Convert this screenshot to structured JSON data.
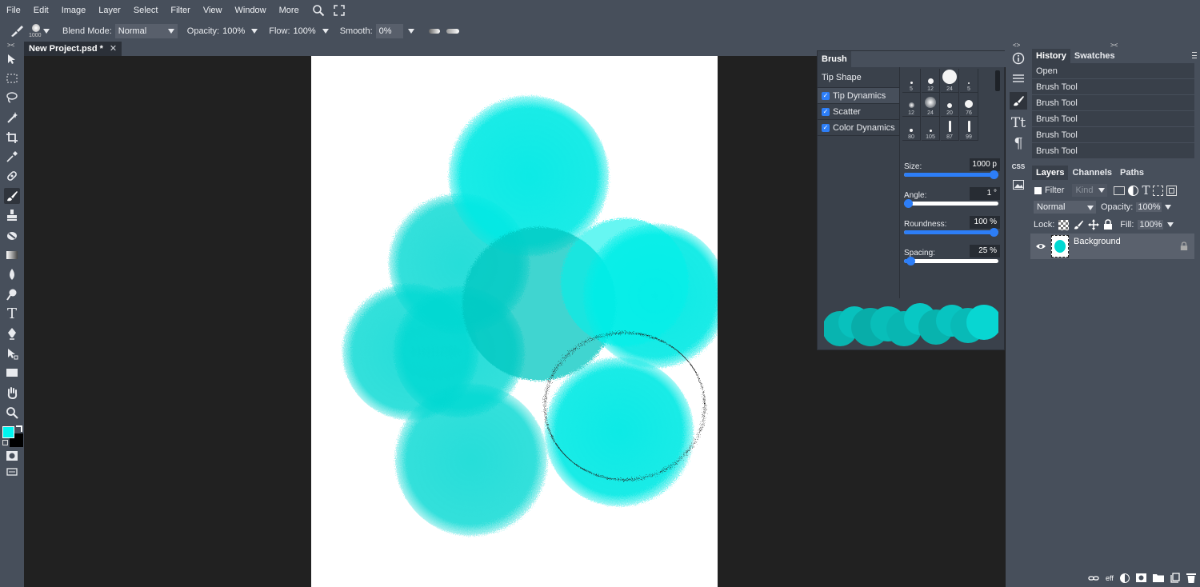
{
  "menu": [
    "File",
    "Edit",
    "Image",
    "Layer",
    "Select",
    "Filter",
    "View",
    "Window",
    "More"
  ],
  "options": {
    "brush_size_label": "1000",
    "blend_mode_label": "Blend Mode:",
    "blend_mode_value": "Normal",
    "opacity_label": "Opacity:",
    "opacity_value": "100%",
    "flow_label": "Flow:",
    "flow_value": "100%",
    "smooth_label": "Smooth:",
    "smooth_value": "0%"
  },
  "document_tab": {
    "title": "New Project.psd *",
    "close": "✕"
  },
  "foreground_color": "#00f5f0",
  "background_color": "#000000",
  "paint_color": "#00e6df",
  "brush_panel": {
    "title": "Brush",
    "tip_shape": "Tip Shape",
    "options": [
      "Tip Dynamics",
      "Scatter",
      "Color Dynamics"
    ],
    "tips": [
      {
        "label": "5"
      },
      {
        "label": "12"
      },
      {
        "label": "24"
      },
      {
        "label": "5"
      },
      {
        "label": "12"
      },
      {
        "label": "24"
      },
      {
        "label": "20"
      },
      {
        "label": "76"
      },
      {
        "label": "80"
      },
      {
        "label": "105"
      },
      {
        "label": "87"
      },
      {
        "label": "99"
      }
    ],
    "size": {
      "label": "Size:",
      "value": "1000 p",
      "fraction": 1.0
    },
    "angle": {
      "label": "Angle:",
      "value": "1 °",
      "fraction": 0.0
    },
    "roundness": {
      "label": "Roundness:",
      "value": "100 %",
      "fraction": 1.0
    },
    "spacing": {
      "label": "Spacing:",
      "value": "25 %",
      "fraction": 0.07
    }
  },
  "history": {
    "tabs": [
      "History",
      "Swatches"
    ],
    "items": [
      "Open",
      "Brush Tool",
      "Brush Tool",
      "Brush Tool",
      "Brush Tool",
      "Brush Tool"
    ]
  },
  "layers": {
    "tabs": [
      "Layers",
      "Channels",
      "Paths"
    ],
    "filter_label": "Filter",
    "kind_value": "Kind",
    "blend_value": "Normal",
    "opacity_label": "Opacity:",
    "opacity_value": "100%",
    "lock_label": "Lock:",
    "fill_label": "Fill:",
    "fill_value": "100%",
    "items": [
      {
        "name": "Background"
      }
    ]
  },
  "bottom": {
    "eff_label": "eff"
  }
}
